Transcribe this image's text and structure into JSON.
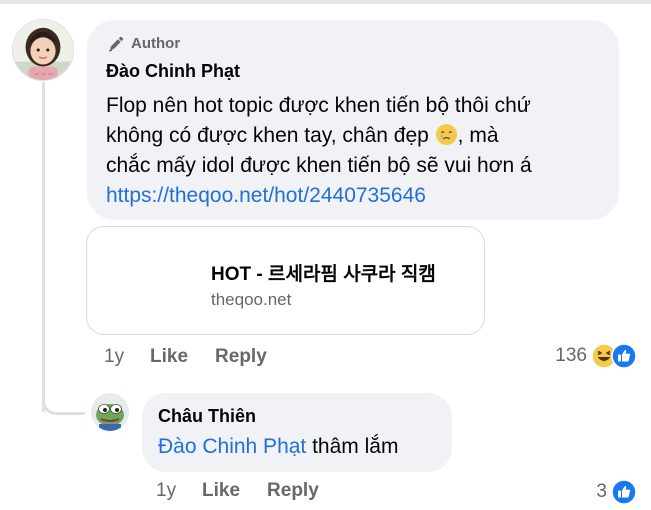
{
  "comment": {
    "author_badge": "Author",
    "author_name": "Đào Chinh Phạt",
    "text_lines": [
      "Flop nên hot topic được khen tiến bộ thôi chứ",
      "không có được khen tay, chân đẹp",
      ", mà",
      "chắc mấy idol được khen tiến bộ sẽ vui hơn á"
    ],
    "link": "https://theqoo.net/hot/2440735646",
    "emoji": "crying-face-emoji",
    "time": "1y",
    "like_label": "Like",
    "reply_label": "Reply",
    "reaction_count": "136",
    "reactions": [
      "haha",
      "like"
    ]
  },
  "link_preview": {
    "title": "HOT - 르세라핌 사쿠라 직캠",
    "domain": "theqoo.net"
  },
  "reply": {
    "author_name": "Châu Thiên",
    "mention": "Đào Chinh Phạt",
    "text": " thâm lắm",
    "time": "1y",
    "like_label": "Like",
    "reply_label": "Reply",
    "reaction_count": "3",
    "reactions": [
      "like"
    ]
  },
  "colors": {
    "link": "#216fdb",
    "bubble": "#f0f2f5",
    "muted_text": "#65676b",
    "like_blue": "#1877f2",
    "haha_yellow": "#f7c94b"
  }
}
